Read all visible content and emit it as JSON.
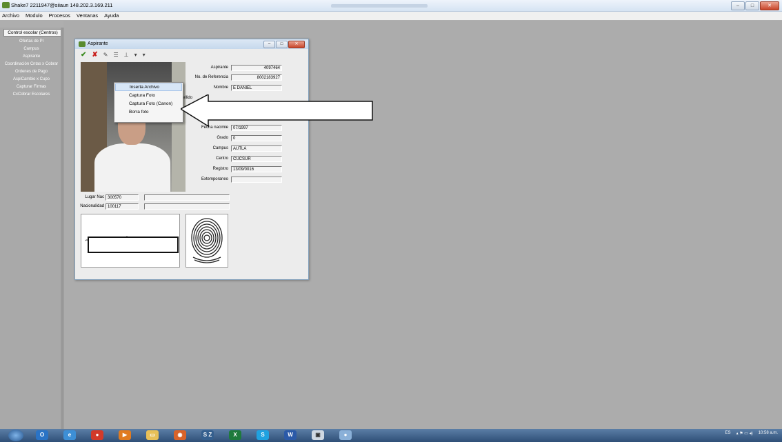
{
  "window": {
    "title": "Shake7 2211947@siiaun  148.202.3.169.211",
    "controls": {
      "minimize": "–",
      "maximize": "□",
      "close": "✕"
    }
  },
  "menubar": [
    "Archivo",
    "Modulo",
    "Procesos",
    "Ventanas",
    "Ayuda"
  ],
  "sidebar": {
    "header": "Control escolar (Centros)",
    "items": [
      "Ofertas de Pl",
      "Campus",
      "Aspirante",
      "Coordinación Cntas x Cobrar",
      "Ordenes de Pago",
      "AspiCambio x Cupo",
      "Capturar Firmas",
      "CxCobrar Escolares"
    ]
  },
  "dialog": {
    "title": "Aspirante",
    "controls": {
      "minimize": "–",
      "maximize": "□",
      "close": "✕"
    },
    "toolbar": {
      "accept_icon": "check-icon",
      "cancel_icon": "cross-icon",
      "dropdown": "▾"
    },
    "fields": {
      "aspirante": {
        "label": "Aspirante",
        "value": "4097464"
      },
      "referencia": {
        "label": "No. de Referencia",
        "value": "8002183927"
      },
      "nombre": {
        "label": "Nombre",
        "value": "E DANIEL"
      },
      "apellido": {
        "label": "pellido",
        "value": ""
      },
      "fecha": {
        "label": "Fecha nacimie",
        "value": "07/1997"
      },
      "grado": {
        "label": "Grado",
        "value": "0"
      },
      "campus": {
        "label": "Campus",
        "value": "AUTLA"
      },
      "centro": {
        "label": "Centro",
        "value": "CUCSUR"
      },
      "registro": {
        "label": "Registro",
        "value": "13/09/0016"
      },
      "extemporaneo": {
        "label": "Extemporaneo",
        "value": ""
      },
      "lugar_nac": {
        "label": "Lugar Nac",
        "value": "300570"
      },
      "nacionalidad": {
        "label": "Nacionalidad",
        "value": "100117"
      }
    }
  },
  "context_menu": {
    "items": [
      "Inserta Archivo",
      "Captura Foto",
      "Captura Foto (Canon)",
      "Borra foto"
    ],
    "selected": 0
  },
  "taskbar": {
    "labels": {
      "sz": "S Z",
      "excel": "X",
      "skype": "S",
      "word": "W"
    },
    "tray": {
      "lang": "ES",
      "time": "10:58 a.m."
    }
  }
}
